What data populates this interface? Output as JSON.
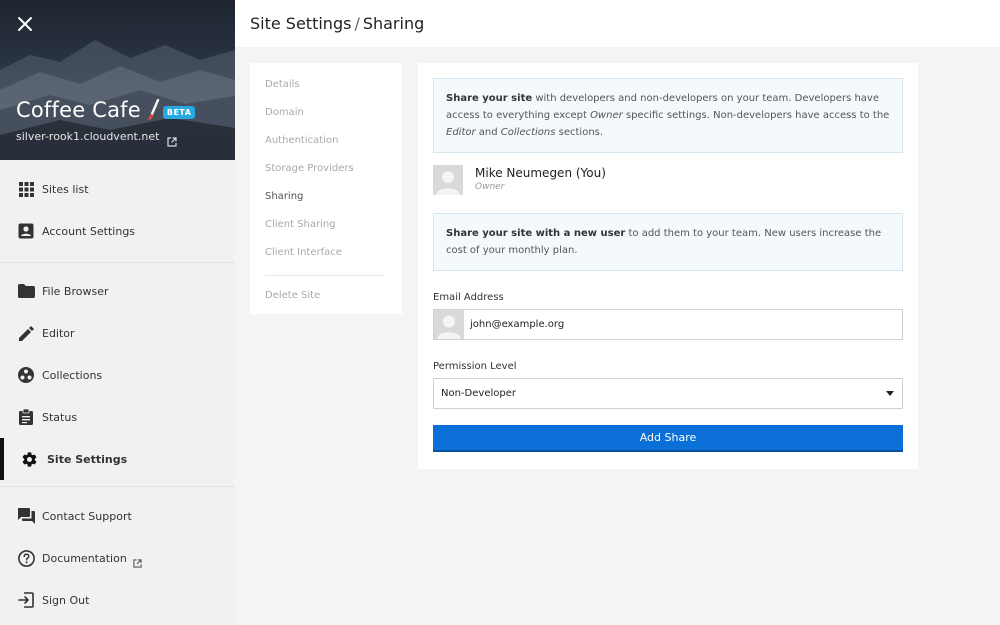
{
  "site": {
    "name": "Coffee Cafe",
    "badge": "BETA",
    "url": "silver-rook1.cloudvent.net"
  },
  "sidebar": {
    "group1": [
      {
        "label": "Sites list",
        "icon": "grid-icon"
      },
      {
        "label": "Account Settings",
        "icon": "account-icon"
      }
    ],
    "group2": [
      {
        "label": "File Browser",
        "icon": "folder-icon"
      },
      {
        "label": "Editor",
        "icon": "pencil-icon"
      },
      {
        "label": "Collections",
        "icon": "collections-icon"
      },
      {
        "label": "Status",
        "icon": "clipboard-icon"
      },
      {
        "label": "Site Settings",
        "icon": "gear-icon",
        "active": true
      }
    ],
    "group3": [
      {
        "label": "Contact Support",
        "icon": "chat-icon"
      },
      {
        "label": "Documentation",
        "icon": "help-icon"
      },
      {
        "label": "Sign Out",
        "icon": "sign-out-icon"
      }
    ]
  },
  "header": {
    "title": "Site Settings",
    "separator": "/",
    "subtitle": "Sharing"
  },
  "settings_nav": {
    "items": [
      "Details",
      "Domain",
      "Authentication",
      "Storage Providers",
      "Sharing",
      "Client Sharing",
      "Client Interface"
    ],
    "active": "Sharing",
    "danger_item": "Delete Site"
  },
  "sharing": {
    "intro": {
      "bold": "Share your site",
      "text1": " with developers and non-developers on your team. Developers have access to everything except ",
      "em1": "Owner",
      "text2": " specific settings. Non-developers have access to the ",
      "em2": "Editor",
      "text3": " and ",
      "em3": "Collections",
      "text4": " sections."
    },
    "owner": {
      "name": "Mike Neumegen (You)",
      "role": "Owner"
    },
    "new_user_notice": {
      "bold": "Share your site with a new user",
      "text": " to add them to your team. New users increase the cost of your monthly plan."
    },
    "email_label": "Email Address",
    "email_value": "john@example.org",
    "permission_label": "Permission Level",
    "permission_value": "Non-Developer",
    "add_button": "Add Share"
  },
  "colors": {
    "primary_button": "#0a6fd6",
    "badge": "#27a8e0",
    "active_indicator": "#111111"
  }
}
